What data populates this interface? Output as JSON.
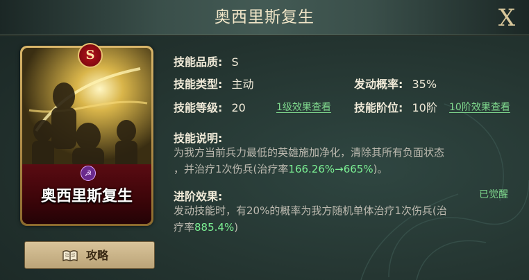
{
  "window": {
    "title": "奥西里斯复生",
    "close_label": "X"
  },
  "card": {
    "grade": "S",
    "name": "奥西里斯复生",
    "emblem_icon": "sickle-hammer-icon"
  },
  "guide_button": {
    "label": "攻略",
    "icon": "book-icon"
  },
  "info": {
    "quality_label": "技能品质:",
    "quality_value": "S",
    "type_label": "技能类型:",
    "type_value": "主动",
    "rate_label": "发动概率:",
    "rate_value": "35%",
    "level_label": "技能等级:",
    "level_value": "20",
    "level_link": "1级效果查看",
    "tier_label": "技能阶位:",
    "tier_value": "10阶",
    "tier_link": "10阶效果查看"
  },
  "description": {
    "label": "技能说明:",
    "line1": "为我方当前兵力最低的英雄施加净化，清除其所有负面状态",
    "line2_prefix": "，并治疗1次伤兵(治疗率",
    "line2_value": "166.26%→665%",
    "line2_suffix": ")。"
  },
  "advanced": {
    "label": "进阶效果:",
    "status": "已觉醒",
    "line1": "发动技能时，有20%的概率为我方随机单体治疗1次伤兵(治",
    "line2_prefix": "疗率",
    "line2_value": "885.4%",
    "line2_suffix": ")"
  },
  "colors": {
    "accent_green": "#7bef93",
    "title_gold": "#f1e6c8",
    "card_red": "#5a0b12"
  }
}
